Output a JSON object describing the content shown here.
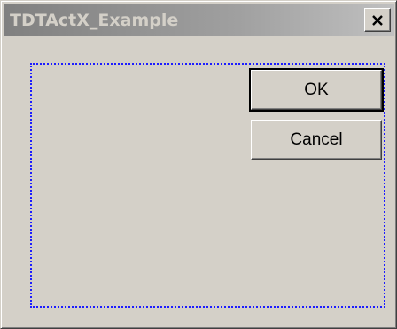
{
  "window": {
    "title": "TDTActX_Example"
  },
  "titlebar": {
    "close_icon": "close-icon"
  },
  "buttons": {
    "ok_label": "OK",
    "cancel_label": "Cancel"
  },
  "colors": {
    "face": "#d4d0c8",
    "title_gradient_start": "#808080",
    "title_gradient_end": "#c0c0c0",
    "focus_frame": "#1c1cff"
  }
}
